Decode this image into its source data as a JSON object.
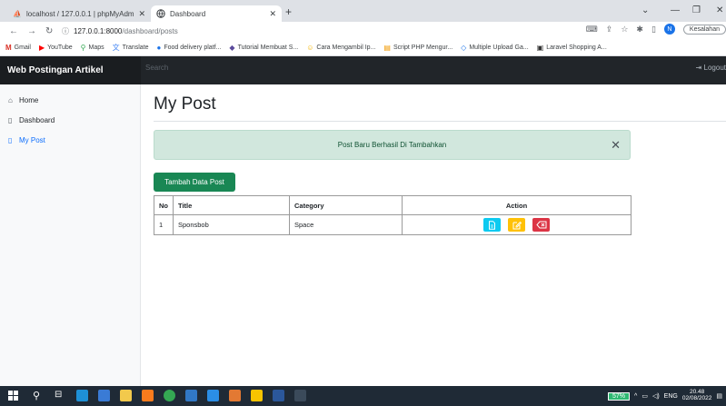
{
  "browser": {
    "tabs": [
      {
        "title": "localhost / 127.0.0.1 | phpMyAdm",
        "active": false
      },
      {
        "title": "Dashboard",
        "active": true
      }
    ],
    "url_host": "127.0.0.1:8000",
    "url_path": "/dashboard/posts",
    "profile_initial": "N",
    "profile_status": "Kesalahan",
    "bookmarks": [
      "Gmail",
      "YouTube",
      "Maps",
      "Translate",
      "Food delivery platf...",
      "Tutorial Membuat S...",
      "Cara Mengambil Ip...",
      "Script PHP Mengur...",
      "Multiple Upload Ga...",
      "Laravel Shopping A..."
    ]
  },
  "app": {
    "brand": "Web Postingan Artikel",
    "search_placeholder": "Search",
    "logout_label": "Logout"
  },
  "sidebar": {
    "items": [
      {
        "label": "Home",
        "icon": "home-icon"
      },
      {
        "label": "Dashboard",
        "icon": "file-icon"
      },
      {
        "label": "My Post",
        "icon": "file-text-icon",
        "active": true
      }
    ]
  },
  "main": {
    "title": "My Post",
    "alert_message": "Post Baru Berhasil Di Tambahkan",
    "add_button": "Tambah Data Post",
    "table": {
      "headers": [
        "No",
        "Title",
        "Category",
        "Action"
      ],
      "rows": [
        {
          "no": "1",
          "title": "Sponsbob",
          "category": "Space"
        }
      ]
    }
  },
  "taskbar": {
    "battery": "57%",
    "language": "ENG",
    "time": "20.48",
    "date": "02/08/2022"
  },
  "colors": {
    "navbar": "#212529",
    "success": "#198754",
    "info": "#0dcaf0",
    "warning": "#ffc107",
    "danger": "#dc3545",
    "link_active": "#0d6efd"
  }
}
